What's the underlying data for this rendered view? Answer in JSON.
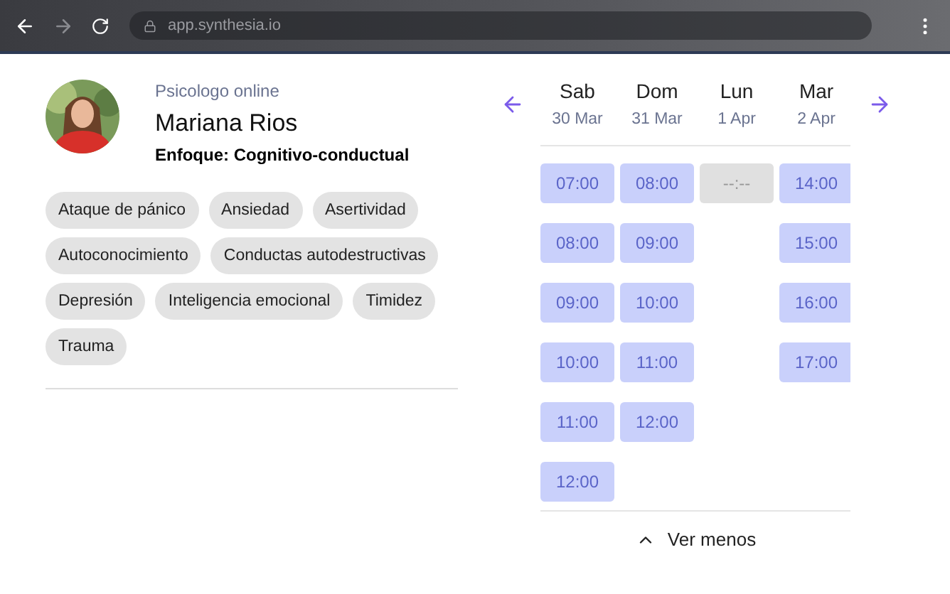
{
  "browser": {
    "url": "app.synthesia.io"
  },
  "profile": {
    "role": "Psicologo online",
    "name": "Mariana Rios",
    "focus": "Enfoque: Cognitivo-conductual"
  },
  "tags": [
    "Ataque de pánico",
    "Ansiedad",
    "Asertividad",
    "Autoconocimiento",
    "Conductas autodestructivas",
    "Depresión",
    "Inteligencia emocional",
    "Timidez",
    "Trauma"
  ],
  "schedule": {
    "days": [
      {
        "day": "Sab",
        "date": "30 Mar",
        "slots": [
          {
            "kind": "available",
            "time": "07:00"
          },
          {
            "kind": "available",
            "time": "08:00"
          },
          {
            "kind": "available",
            "time": "09:00"
          },
          {
            "kind": "available",
            "time": "10:00"
          },
          {
            "kind": "available",
            "time": "11:00"
          },
          {
            "kind": "available",
            "time": "12:00"
          }
        ]
      },
      {
        "day": "Dom",
        "date": "31 Mar",
        "slots": [
          {
            "kind": "available",
            "time": "08:00"
          },
          {
            "kind": "available",
            "time": "09:00"
          },
          {
            "kind": "available",
            "time": "10:00"
          },
          {
            "kind": "available",
            "time": "11:00"
          },
          {
            "kind": "available",
            "time": "12:00"
          }
        ]
      },
      {
        "day": "Lun",
        "date": "1 Apr",
        "slots": [
          {
            "kind": "empty",
            "time": "--:--"
          }
        ]
      },
      {
        "day": "Mar",
        "date": "2 Apr",
        "slots": [
          {
            "kind": "available",
            "time": "14:00"
          },
          {
            "kind": "available",
            "time": "15:00"
          },
          {
            "kind": "available",
            "time": "16:00"
          },
          {
            "kind": "available",
            "time": "17:00"
          }
        ]
      }
    ],
    "toggle": "Ver menos"
  }
}
